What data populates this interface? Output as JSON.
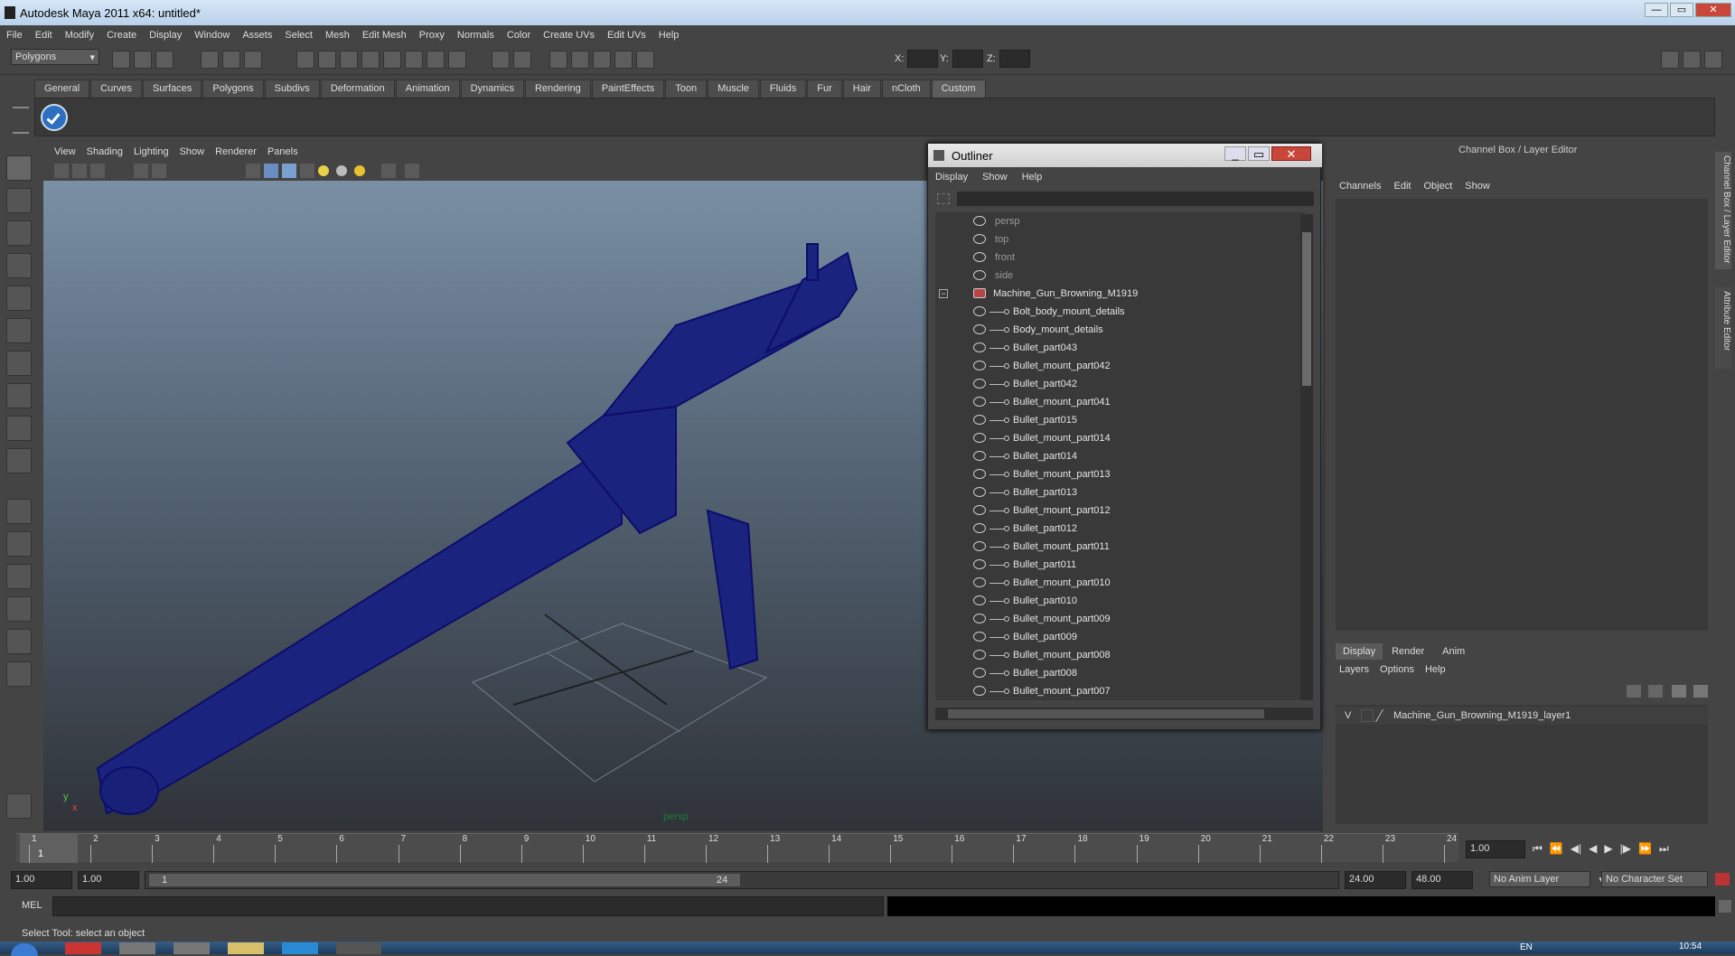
{
  "window": {
    "title": "Autodesk Maya 2011 x64: untitled*",
    "buttons": [
      "—",
      "▭",
      "✕"
    ]
  },
  "menubar": [
    "File",
    "Edit",
    "Modify",
    "Create",
    "Display",
    "Window",
    "Assets",
    "Select",
    "Mesh",
    "Edit Mesh",
    "Proxy",
    "Normals",
    "Color",
    "Create UVs",
    "Edit UVs",
    "Help"
  ],
  "statusline": {
    "mode": "Polygons",
    "x_label": "X:",
    "y_label": "Y:",
    "z_label": "Z:"
  },
  "shelf": {
    "tabs": [
      "General",
      "Curves",
      "Surfaces",
      "Polygons",
      "Subdivs",
      "Deformation",
      "Animation",
      "Dynamics",
      "Rendering",
      "PaintEffects",
      "Toon",
      "Muscle",
      "Fluids",
      "Fur",
      "Hair",
      "nCloth",
      "Custom"
    ],
    "active": "Custom"
  },
  "viewport": {
    "menus": [
      "View",
      "Shading",
      "Lighting",
      "Show",
      "Renderer",
      "Panels"
    ],
    "camera_label": "persp",
    "axis_x": "x",
    "axis_y": "y"
  },
  "outliner": {
    "title": "Outliner",
    "menus": [
      "Display",
      "Show",
      "Help"
    ],
    "items": [
      {
        "name": "persp",
        "type": "camera"
      },
      {
        "name": "top",
        "type": "camera"
      },
      {
        "name": "front",
        "type": "camera"
      },
      {
        "name": "side",
        "type": "camera"
      },
      {
        "name": "Machine_Gun_Browning_M1919",
        "type": "group"
      },
      {
        "name": "Bolt_body_mount_details",
        "type": "mesh"
      },
      {
        "name": "Body_mount_details",
        "type": "mesh"
      },
      {
        "name": "Bullet_part043",
        "type": "mesh"
      },
      {
        "name": "Bullet_mount_part042",
        "type": "mesh"
      },
      {
        "name": "Bullet_part042",
        "type": "mesh"
      },
      {
        "name": "Bullet_mount_part041",
        "type": "mesh"
      },
      {
        "name": "Bullet_part015",
        "type": "mesh"
      },
      {
        "name": "Bullet_mount_part014",
        "type": "mesh"
      },
      {
        "name": "Bullet_part014",
        "type": "mesh"
      },
      {
        "name": "Bullet_mount_part013",
        "type": "mesh"
      },
      {
        "name": "Bullet_part013",
        "type": "mesh"
      },
      {
        "name": "Bullet_mount_part012",
        "type": "mesh"
      },
      {
        "name": "Bullet_part012",
        "type": "mesh"
      },
      {
        "name": "Bullet_mount_part011",
        "type": "mesh"
      },
      {
        "name": "Bullet_part011",
        "type": "mesh"
      },
      {
        "name": "Bullet_mount_part010",
        "type": "mesh"
      },
      {
        "name": "Bullet_part010",
        "type": "mesh"
      },
      {
        "name": "Bullet_mount_part009",
        "type": "mesh"
      },
      {
        "name": "Bullet_part009",
        "type": "mesh"
      },
      {
        "name": "Bullet_mount_part008",
        "type": "mesh"
      },
      {
        "name": "Bullet_part008",
        "type": "mesh"
      },
      {
        "name": "Bullet_mount_part007",
        "type": "mesh"
      }
    ]
  },
  "channelbox": {
    "title": "Channel Box / Layer Editor",
    "menus": [
      "Channels",
      "Edit",
      "Object",
      "Show"
    ],
    "side_tabs": [
      "Channel Box / Layer Editor",
      "Attribute Editor"
    ]
  },
  "layers": {
    "tabs": [
      "Display",
      "Render",
      "Anim"
    ],
    "active": "Display",
    "menus": [
      "Layers",
      "Options",
      "Help"
    ],
    "layer": {
      "visible": "V",
      "name": "Machine_Gun_Browning_M1919_layer1"
    }
  },
  "timeline": {
    "ticks": [
      "1",
      "2",
      "3",
      "4",
      "5",
      "6",
      "7",
      "8",
      "9",
      "10",
      "11",
      "12",
      "13",
      "14",
      "15",
      "16",
      "17",
      "18",
      "19",
      "20",
      "21",
      "22",
      "23",
      "24"
    ],
    "current_frame": "1",
    "current_field": "1.00"
  },
  "range": {
    "start": "1.00",
    "playback_start": "1.00",
    "slider_start": "1",
    "slider_end": "24",
    "playback_end": "24.00",
    "end": "48.00",
    "anim_layer": "No Anim Layer",
    "char_set": "No Character Set"
  },
  "cmd": {
    "label": "MEL"
  },
  "help": {
    "text": "Select Tool: select an object"
  },
  "taskbar": {
    "clock": "10:54",
    "lang": "EN"
  }
}
